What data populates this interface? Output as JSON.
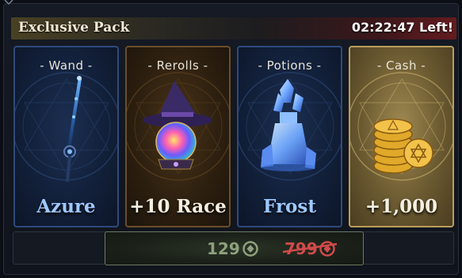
{
  "header": {
    "title": "Exclusive Pack",
    "timer": "02:22:47 Left!"
  },
  "cards": [
    {
      "label": "- Wand -",
      "value": "Azure"
    },
    {
      "label": "- Rerolls -",
      "value": "+10 Race"
    },
    {
      "label": "- Potions -",
      "value": "Frost"
    },
    {
      "label": "- Cash -",
      "value": "+1,000"
    }
  ],
  "purchase": {
    "price": "129",
    "original_price": "799",
    "currency_icon": "gem-coin-icon"
  },
  "colors": {
    "rare_blue": "#2e4a7c",
    "epic_brown": "#6b4e2a",
    "legendary_gold": "#b89e5c",
    "discount_red": "#d14a4a",
    "price_green": "#8ea07c"
  }
}
